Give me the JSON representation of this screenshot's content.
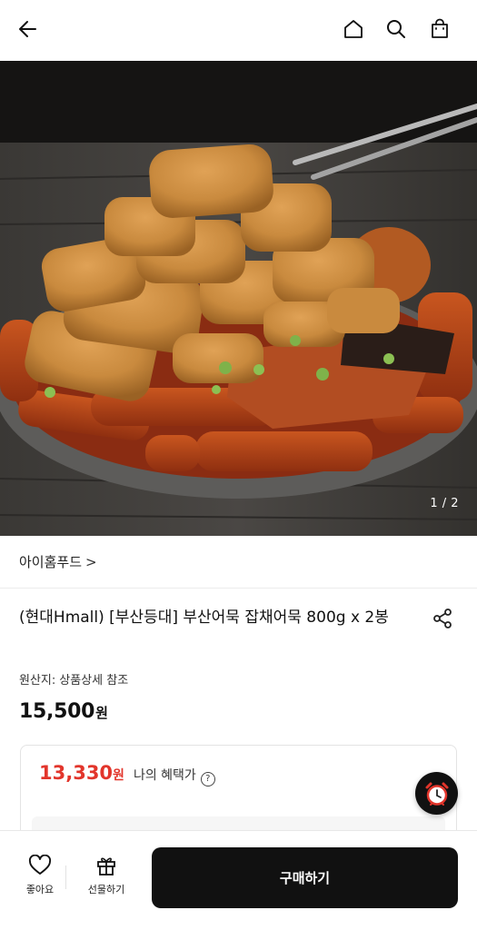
{
  "header": {
    "back_icon": "arrow-left-icon",
    "home_icon": "home-icon",
    "search_icon": "search-icon",
    "cart_icon": "shopping-bag-icon"
  },
  "gallery": {
    "current": 1,
    "total": 2,
    "pager_text": "1 / 2"
  },
  "product": {
    "brand": "아이홈푸드",
    "brand_chevron": ">",
    "title": "(현대Hmall) [부산등대] 부산어묵 잡채어묵 800g x 2봉",
    "origin_label": "원산지:",
    "origin_value": "상품상세 참조",
    "price": "15,500",
    "price_unit": "원"
  },
  "benefit": {
    "price": "13,330",
    "unit": "원",
    "label": "나의 혜택가",
    "help": "?"
  },
  "bottom_bar": {
    "like_label": "좋아요",
    "gift_label": "선물하기",
    "buy_label": "구매하기"
  },
  "colors": {
    "accent_red": "#e2352b",
    "buy_button": "#111111"
  }
}
